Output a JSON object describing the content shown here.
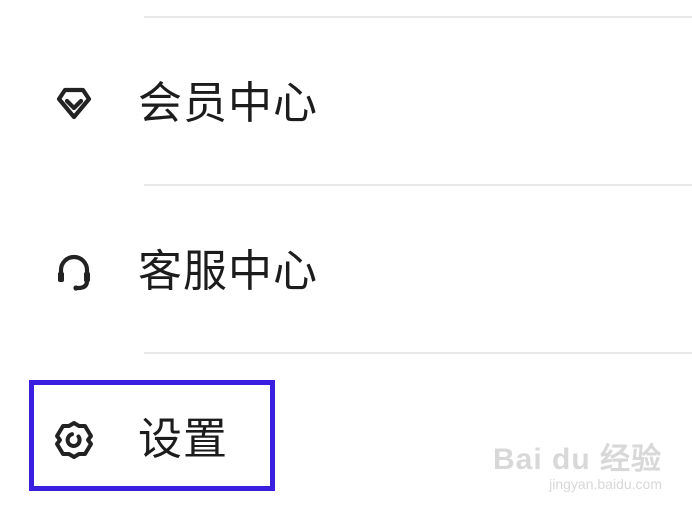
{
  "menu": {
    "items": [
      {
        "label": "会员中心",
        "icon": "vip-diamond-icon"
      },
      {
        "label": "客服中心",
        "icon": "headset-icon"
      },
      {
        "label": "设置",
        "icon": "gear-icon"
      }
    ]
  },
  "highlight": {
    "color": "#3b1fe0"
  },
  "watermark": {
    "brand": "Bai du 经验",
    "url": "jingyan.baidu.com"
  }
}
